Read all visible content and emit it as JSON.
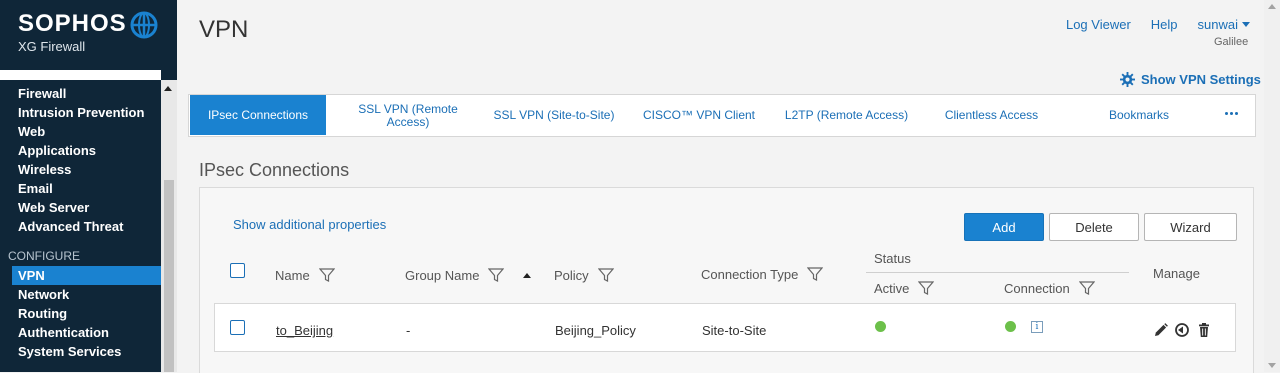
{
  "brand": {
    "name": "SOPHOS",
    "product": "XG Firewall"
  },
  "sidebar": {
    "items": [
      {
        "label": "Firewall"
      },
      {
        "label": "Intrusion Prevention"
      },
      {
        "label": "Web"
      },
      {
        "label": "Applications"
      },
      {
        "label": "Wireless"
      },
      {
        "label": "Email"
      },
      {
        "label": "Web Server"
      },
      {
        "label": "Advanced Threat"
      }
    ],
    "section": "CONFIGURE",
    "configure_items": [
      {
        "label": "VPN",
        "active": true
      },
      {
        "label": "Network"
      },
      {
        "label": "Routing"
      },
      {
        "label": "Authentication"
      },
      {
        "label": "System Services"
      }
    ]
  },
  "header": {
    "title": "VPN",
    "log_viewer": "Log Viewer",
    "help": "Help",
    "user": "sunwai",
    "org": "Galilee",
    "show_settings": "Show VPN Settings"
  },
  "tabs": [
    {
      "label": "IPsec Connections",
      "active": true
    },
    {
      "label": "SSL VPN (Remote Access)"
    },
    {
      "label": "SSL VPN (Site-to-Site)"
    },
    {
      "label": "CISCO™ VPN Client"
    },
    {
      "label": "L2TP (Remote Access)"
    },
    {
      "label": "Clientless Access"
    },
    {
      "label": "Bookmarks"
    }
  ],
  "section": {
    "title": "IPsec Connections",
    "show_props": "Show additional properties",
    "buttons": {
      "add": "Add",
      "delete": "Delete",
      "wizard": "Wizard"
    }
  },
  "table": {
    "columns": {
      "name": "Name",
      "group": "Group Name",
      "policy": "Policy",
      "conn_type": "Connection Type",
      "status": "Status",
      "active": "Active",
      "connection": "Connection",
      "manage": "Manage"
    },
    "rows": [
      {
        "name": "to_Beijing",
        "group": "-",
        "policy": "Beijing_Policy",
        "conn_type": "Site-to-Site",
        "active": "green",
        "connection": "green"
      }
    ]
  },
  "colors": {
    "accent": "#1a82d0",
    "sidebar": "#0f2638",
    "status_ok": "#6cc04a",
    "link": "#1b6fb6"
  }
}
